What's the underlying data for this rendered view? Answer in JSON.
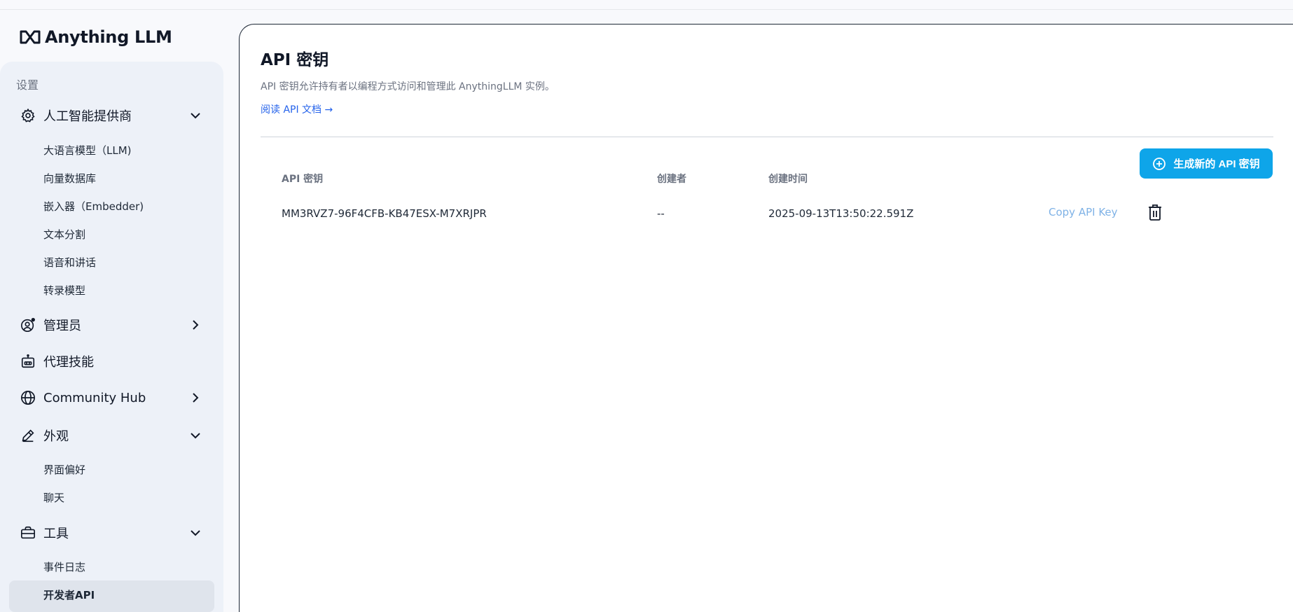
{
  "app": {
    "title": "Anything LLM"
  },
  "sidebar": {
    "section_label": "设置",
    "groups": [
      {
        "label": "人工智能提供商",
        "icon": "gear-icon",
        "expanded": true,
        "items": [
          "大语言模型（LLM)",
          "向量数据库",
          "嵌入器（Embedder)",
          "文本分割",
          "语音和讲话",
          "转录模型"
        ]
      },
      {
        "label": "管理员",
        "icon": "admin-user-icon",
        "expanded": false,
        "items": []
      },
      {
        "label": "代理技能",
        "icon": "robot-icon",
        "expanded": false,
        "items": []
      },
      {
        "label": "Community Hub",
        "icon": "globe-icon",
        "expanded": false,
        "items": []
      },
      {
        "label": "外观",
        "icon": "pencil-icon",
        "expanded": true,
        "items": [
          "界面偏好",
          "聊天"
        ]
      },
      {
        "label": "工具",
        "icon": "briefcase-icon",
        "expanded": true,
        "items": [
          "事件日志",
          "开发者API"
        ]
      }
    ],
    "active_item": "开发者API"
  },
  "main": {
    "title": "API 密钥",
    "description": "API 密钥允许持有者以编程方式访问和管理此 AnythingLLM 实例。",
    "doc_link": "阅读 API 文档",
    "generate_button": "生成新的 API 密钥",
    "table": {
      "headers": [
        "API 密钥",
        "创建者",
        "创建时间"
      ],
      "rows": [
        {
          "key": "MM3RVZ7-96F4CFB-KB47ESX-M7XRJPR",
          "creator": "--",
          "created": "2025-09-13T13:50:22.591Z",
          "copy_label": "Copy API Key"
        }
      ]
    }
  },
  "colors": {
    "accent": "#0ea5e9",
    "link": "#2563eb",
    "sidebar_bg": "#edf1f8",
    "active_bg": "#dfe4ec"
  }
}
